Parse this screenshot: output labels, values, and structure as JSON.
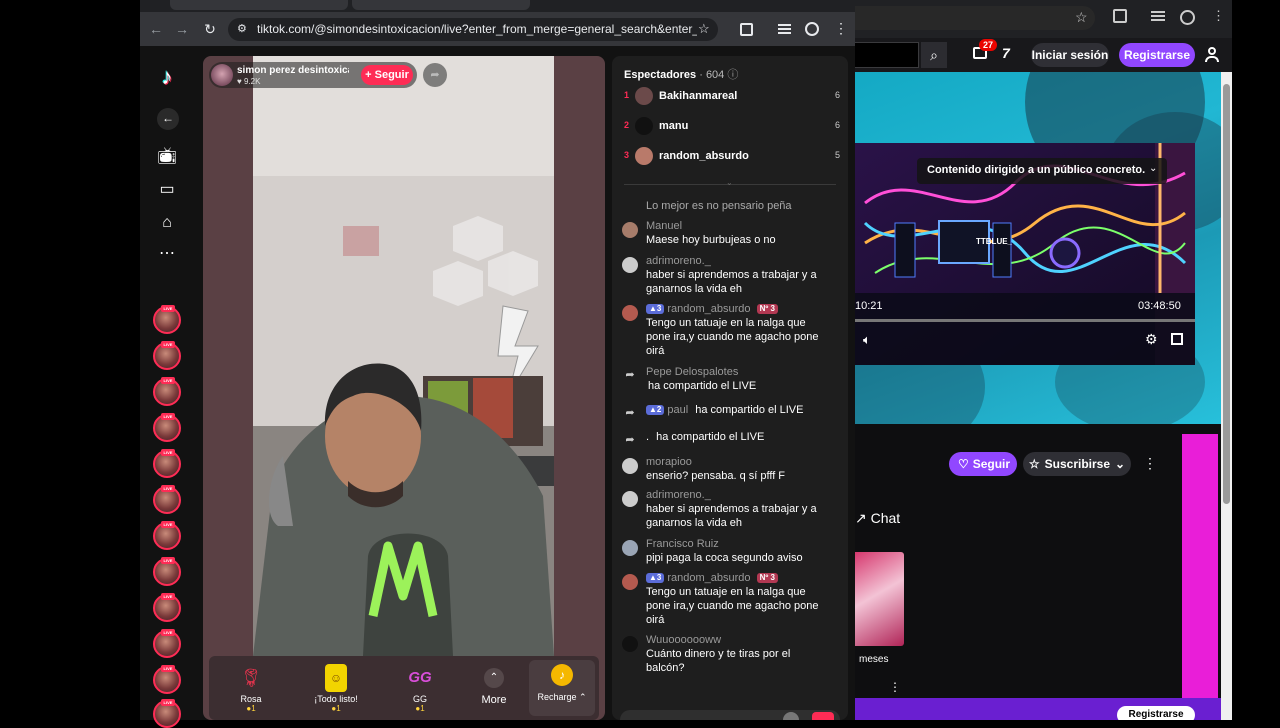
{
  "twitch": {
    "notif_count": "27",
    "login_label": "Iniciar sesión",
    "register_label": "Registrarse",
    "video_overlay_label": "Contenido dirigido a un público concreto.",
    "video_brand_label": "TTBLUE_",
    "video_time_left": "10:21",
    "video_time_right": "03:48:50",
    "follow_label": "Seguir",
    "subscribe_label": "Suscribirse",
    "chat_label": "Chat",
    "months_label": "meses",
    "bottom_register_label": "Registrarse"
  },
  "browser": {
    "url": "tiktok.com/@simondesintoxicacion/live?enter_from_merge=general_search&enter_method=..."
  },
  "tiktok": {
    "host_name": "simon perez desintoxica...",
    "host_likes": "9.2K",
    "follow_label": "+ Seguir",
    "viewers_label": "Espectadores",
    "viewers_count": "· 604",
    "ranking": [
      {
        "rank": "1",
        "name": "Bakihanmareal",
        "score": "6"
      },
      {
        "rank": "2",
        "name": "manu",
        "score": "6"
      },
      {
        "rank": "3",
        "name": "random_absurdo",
        "score": "5"
      }
    ],
    "messages": [
      {
        "user": "",
        "text": "Lo mejor es no pensario peña"
      },
      {
        "user": "Manuel",
        "text": "Maese hoy burbujeas o no"
      },
      {
        "user": "adrimoreno._",
        "text": "haber si aprendemos a trabajar y a ganarnos la vida eh"
      },
      {
        "user": "random_absurdo",
        "level": "3",
        "fan": "Nº 3",
        "text": "Tengo un tatuaje en la nalga que pone ira,y cuando me agacho pone oirá"
      },
      {
        "user": "Pepe Delospalotes",
        "text": "ha compartido el LIVE"
      },
      {
        "user": "paul",
        "level": "2",
        "text": "ha compartido el LIVE"
      },
      {
        "user": ".",
        "text": "ha compartido el LIVE"
      },
      {
        "user": "morapioo",
        "text": "enserio? pensaba. q sí pfff F"
      },
      {
        "user": "adrimoreno._",
        "text": "haber si aprendemos a trabajar y a ganarnos la vida eh"
      },
      {
        "user": "Francisco Ruiz",
        "text": "pipi paga la coca segundo aviso"
      },
      {
        "user": "random_absurdo",
        "level": "3",
        "fan": "Nº 3",
        "text": "Tengo un tatuaje en la nalga que pone ira,y cuando me agacho pone oirá"
      },
      {
        "user": "Wuuooooooww",
        "text": "Cuánto dinero y te tiras por el balcón?"
      }
    ],
    "gifts": [
      {
        "label": "Rosa",
        "cost": "1"
      },
      {
        "label": "¡Todo listo!",
        "cost": "1"
      },
      {
        "label": "GG",
        "cost": "1"
      }
    ],
    "more_label": "More",
    "recharge_label": "Recharge"
  },
  "colors": {
    "tiktok_accent": "#fe2c55",
    "twitch_accent": "#9147ff"
  }
}
